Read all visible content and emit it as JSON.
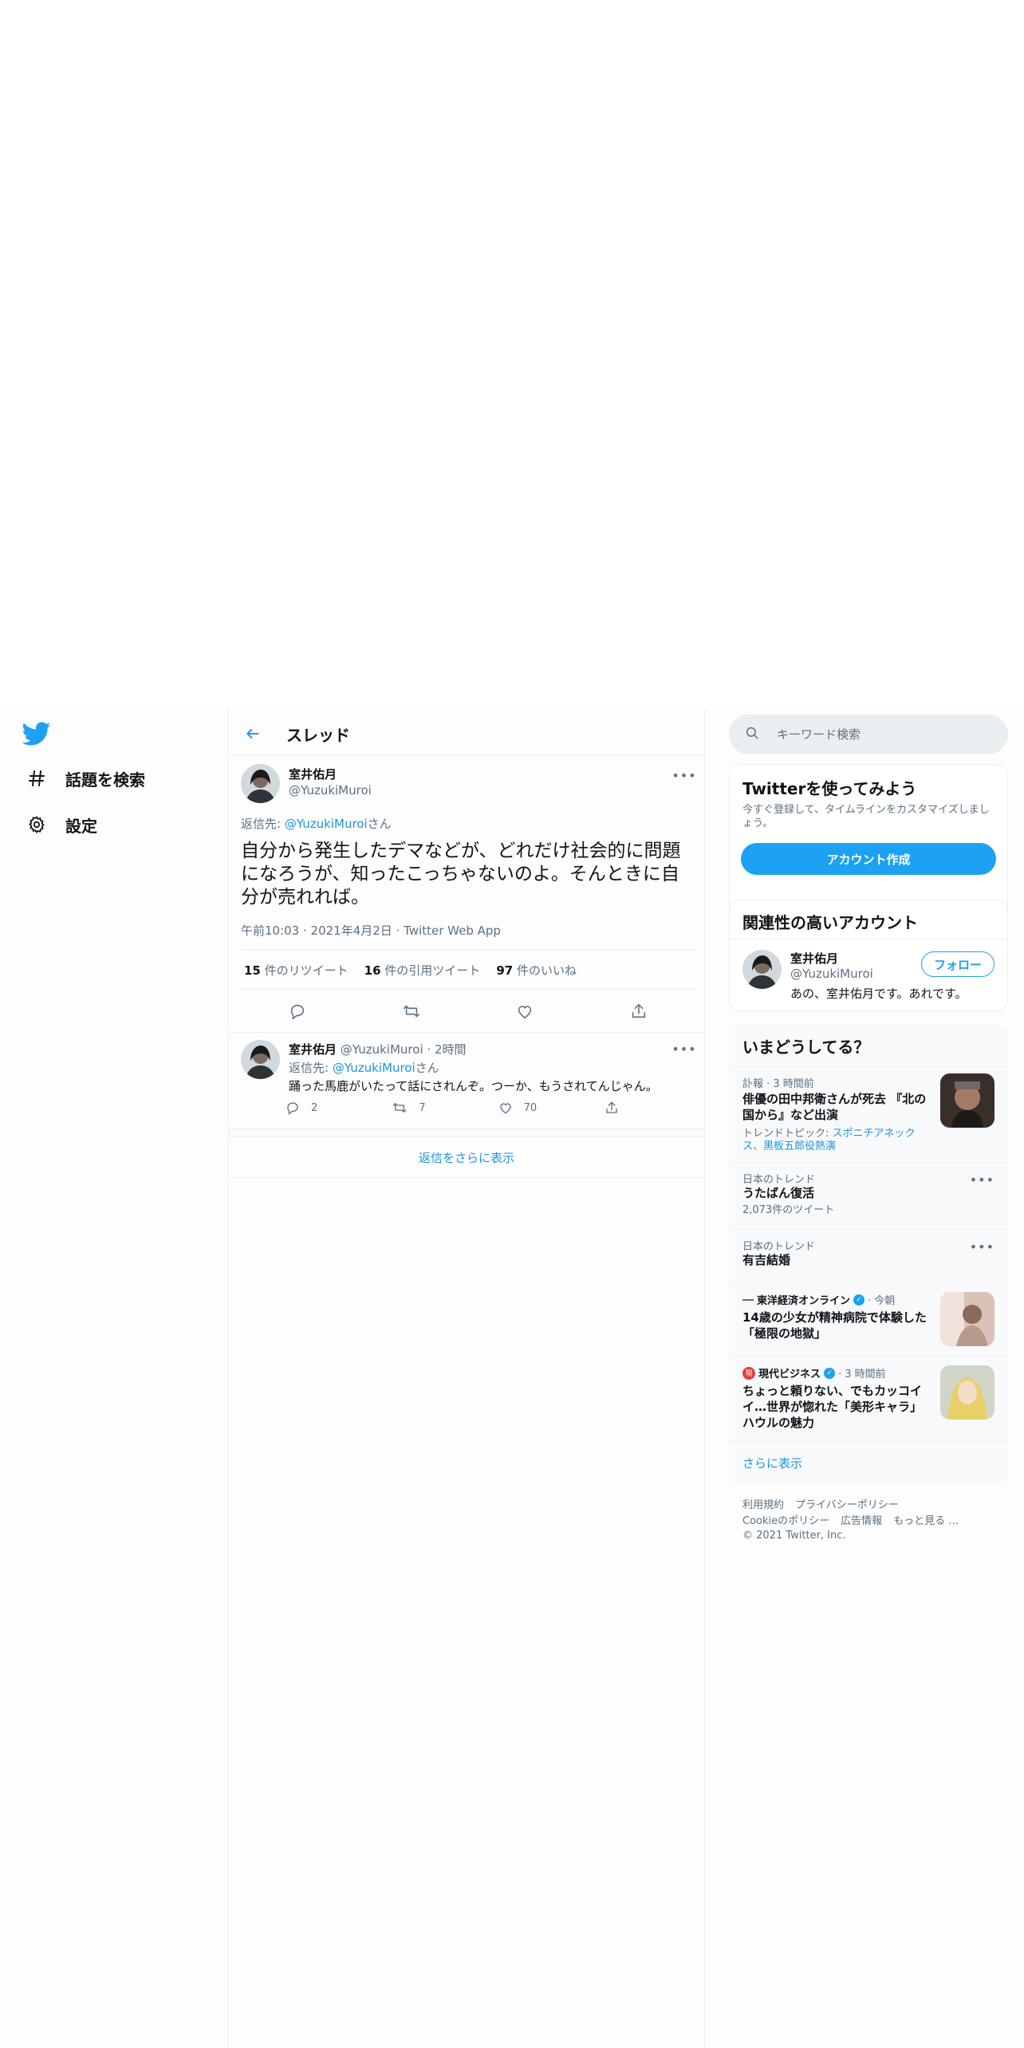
{
  "nav": {
    "logo": "twitter-bird-icon",
    "items": [
      {
        "label": "話題を検索",
        "icon": "hashtag-icon"
      },
      {
        "label": "設定",
        "icon": "gear-icon"
      }
    ]
  },
  "header": {
    "title": "スレッド"
  },
  "main_tweet": {
    "name": "室井佑月",
    "handle": "@YuzukiMuroi",
    "reply_to_prefix": "返信先: ",
    "reply_to_handle": "@YuzukiMuroi",
    "reply_to_suffix": "さん",
    "text": "自分から発生したデマなどが、どれだけ社会的に問題になろうが、知ったこっちゃないのよ。そんときに自分が売れれば。",
    "time": "午前10:03 · 2021年4月2日 · Twitter Web App",
    "retweets_count": "15",
    "retweets_label": " 件のリツイート",
    "quotes_count": "16",
    "quotes_label": " 件の引用ツイート",
    "likes_count": "97",
    "likes_label": " 件のいいね"
  },
  "reply_tweet": {
    "name": "室井佑月",
    "handle": "@YuzukiMuroi",
    "time": "· 2時間",
    "reply_to_prefix": "返信先: ",
    "reply_to_handle": "@YuzukiMuroi",
    "reply_to_suffix": "さん",
    "text": "踊った馬鹿がいたって話にされんぞ。つーか、もうされてんじゃん。",
    "replies": "2",
    "retweets": "7",
    "likes": "70"
  },
  "show_more_replies": "返信をさらに表示",
  "search": {
    "placeholder": "キーワード検索"
  },
  "signup_card": {
    "title": "Twitterを使ってみよう",
    "desc": "今すぐ登録して、タイムラインをカスタマイズしましょう。",
    "button": "アカウント作成"
  },
  "related_card": {
    "title": "関連性の高いアカウント",
    "name": "室井佑月",
    "handle": "@YuzukiMuroi",
    "follow": "フォロー",
    "bio": "あの、室井佑月です。あれです。"
  },
  "trends": {
    "title": "いまどうしてる？",
    "items": [
      {
        "category": "訃報 · 3 時間前",
        "title": "俳優の田中邦衛さんが死去 『北の国から』など出演",
        "sub_prefix": "トレンドトピック: ",
        "sub_links": "スポニチアネックス、黒板五郎役熱演"
      },
      {
        "category": "日本のトレンド",
        "title": "うたばん復活",
        "sub": "2,073件のツイート"
      },
      {
        "category": "日本のトレンド",
        "title": "有吉結婚"
      },
      {
        "source": "東洋経済オンライン",
        "time": "· 今朝",
        "title": "14歳の少女が精神病院で体験した「極限の地獄」"
      },
      {
        "source": "現代ビジネス",
        "time": "· 3 時間前",
        "title": "ちょっと頼りない、でもカッコイイ…世界が惚れた「美形キャラ」ハウルの魅力"
      }
    ],
    "show_more": "さらに表示"
  },
  "footer": {
    "terms": "利用規約",
    "privacy": "プライバシーポリシー",
    "cookie": "Cookieのポリシー",
    "ads": "広告情報",
    "more": "もっと見る …",
    "copyright": "© 2021 Twitter, Inc."
  },
  "colors": {
    "accent": "#1da1f2",
    "link": "#1b95e0",
    "muted": "#5b7083",
    "border": "#ebeef0"
  }
}
